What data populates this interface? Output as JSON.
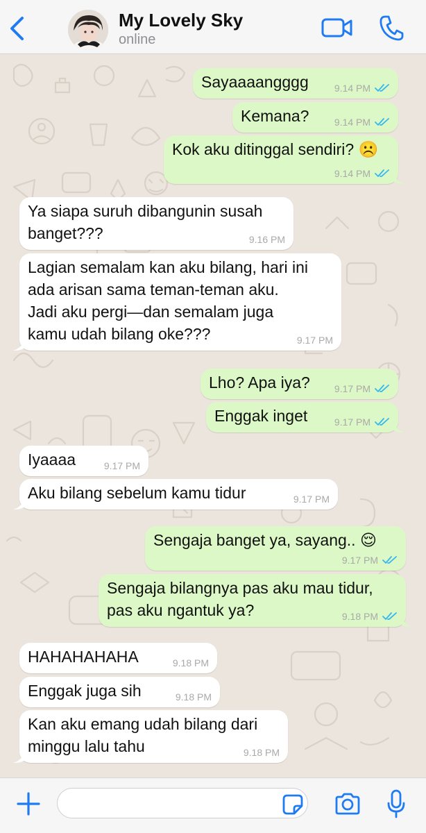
{
  "header": {
    "name": "My Lovely Sky",
    "status": "online"
  },
  "colors": {
    "accent": "#1e7bf2",
    "outgoing_bubble": "#dcf8c6",
    "incoming_bubble": "#ffffff",
    "chat_background": "#ece5dd",
    "read_ticks": "#34b7f1"
  },
  "icons": [
    "chevron-left-icon",
    "video-camera-icon",
    "phone-icon",
    "plus-icon",
    "sticker-icon",
    "camera-icon",
    "microphone-icon",
    "double-check-icon"
  ],
  "messages": [
    {
      "dir": "out",
      "text": "Sayaaaangggg",
      "time": "9.14 PM",
      "read": true
    },
    {
      "dir": "out",
      "text": "Kemana?",
      "time": "9.14 PM",
      "read": true
    },
    {
      "dir": "out",
      "text": "Kok aku ditinggal sendiri? ☹️",
      "time": "9.14 PM",
      "read": true
    },
    {
      "dir": "in",
      "text": "Ya siapa suruh dibangunin susah\nbanget???",
      "time": "9.16 PM"
    },
    {
      "dir": "in",
      "text": "Lagian semalam kan aku bilang, hari ini\nada arisan sama teman-teman aku.\nJadi aku pergi—dan semalam juga\nkamu udah bilang oke???",
      "time": "9.17 PM"
    },
    {
      "dir": "out",
      "text": "Lho? Apa iya?",
      "time": "9.17 PM",
      "read": true
    },
    {
      "dir": "out",
      "text": "Enggak inget",
      "time": "9.17 PM",
      "read": true
    },
    {
      "dir": "in",
      "text": "Iyaaaa",
      "time": "9.17 PM"
    },
    {
      "dir": "in",
      "text": "Aku bilang sebelum kamu tidur",
      "time": "9.17 PM"
    },
    {
      "dir": "out",
      "text": "Sengaja banget ya, sayang.. 😌",
      "time": "9.17 PM",
      "read": true
    },
    {
      "dir": "out",
      "text": "Sengaja bilangnya pas aku mau tidur,\npas aku ngantuk ya?",
      "time": "9.18 PM",
      "read": true
    },
    {
      "dir": "in",
      "text": "HAHAHAHAHA",
      "time": "9.18 PM"
    },
    {
      "dir": "in",
      "text": "Enggak juga sih",
      "time": "9.18 PM"
    },
    {
      "dir": "in",
      "text": "Kan aku emang udah bilang dari\nminggu lalu tahu",
      "time": "9.18 PM"
    }
  ],
  "composer": {
    "input_value": "",
    "placeholder": ""
  }
}
